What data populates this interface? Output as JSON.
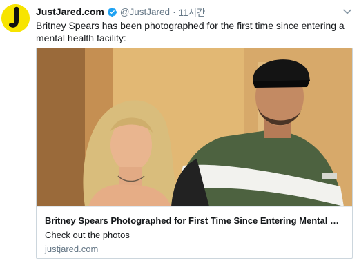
{
  "tweet": {
    "display_name": "JustJared.com",
    "handle": "@JustJared",
    "separator": "·",
    "timestamp": "11시간",
    "text": "Britney Spears has been photographed for the first time since entering a mental health facility:"
  },
  "card": {
    "title": "Britney Spears Photographed for First Time Since Entering Mental H...",
    "description": "Check out the photos",
    "domain": "justjared.com"
  },
  "icons": {
    "avatar": "justjared-logo-icon",
    "verified": "verified-badge-icon",
    "menu": "chevron-down-icon"
  },
  "colors": {
    "avatar_bg": "#f7e400",
    "verified": "#1da1f2",
    "secondary_text": "#657786",
    "card_border": "#ccd6dd"
  }
}
